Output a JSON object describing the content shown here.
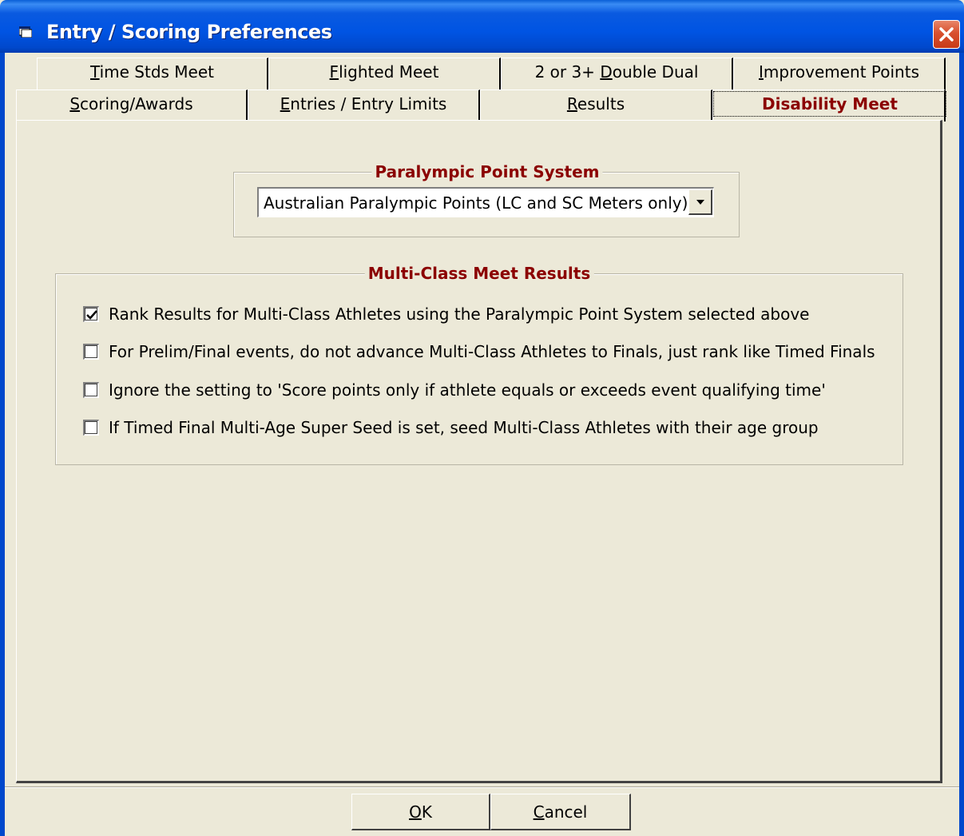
{
  "window": {
    "title": "Entry / Scoring Preferences",
    "icon": "app-window-icon",
    "close_icon": "close-icon",
    "titlebar_color": "#0054E3",
    "accent_text_color": "#8B0000"
  },
  "tabs_back": [
    {
      "pre": "",
      "u": "T",
      "post": "ime Stds Meet"
    },
    {
      "pre": "",
      "u": "F",
      "post": "lighted Meet"
    },
    {
      "pre": "2 or 3+ ",
      "u": "D",
      "post": "ouble Dual"
    },
    {
      "pre": "",
      "u": "I",
      "post": "mprovement Points"
    }
  ],
  "tabs_front": [
    {
      "pre": "",
      "u": "S",
      "post": "coring/Awards"
    },
    {
      "pre": "",
      "u": "E",
      "post": "ntries / Entry Limits"
    },
    {
      "pre": "",
      "u": "R",
      "post": "esults"
    },
    {
      "label": "Disability Meet",
      "selected": true
    }
  ],
  "paralympic": {
    "group_title": "Paralympic Point System",
    "selected": "Australian Paralympic Points (LC and SC Meters only)"
  },
  "multiclass": {
    "group_title": "Multi-Class Meet Results",
    "options": [
      {
        "label": "Rank Results for Multi-Class Athletes using the Paralympic Point System selected above",
        "checked": true
      },
      {
        "label": "For Prelim/Final events, do not advance Multi-Class Athletes to Finals, just rank like Timed Finals",
        "checked": false
      },
      {
        "label": "Ignore the setting to 'Score points only if athlete equals or exceeds event qualifying time'",
        "checked": false
      },
      {
        "label": "If Timed Final Multi-Age Super Seed is set, seed Multi-Class Athletes with their age group",
        "checked": false
      }
    ]
  },
  "buttons": {
    "ok": {
      "u": "O",
      "post": "K"
    },
    "cancel": {
      "u": "C",
      "post": "ancel"
    }
  }
}
